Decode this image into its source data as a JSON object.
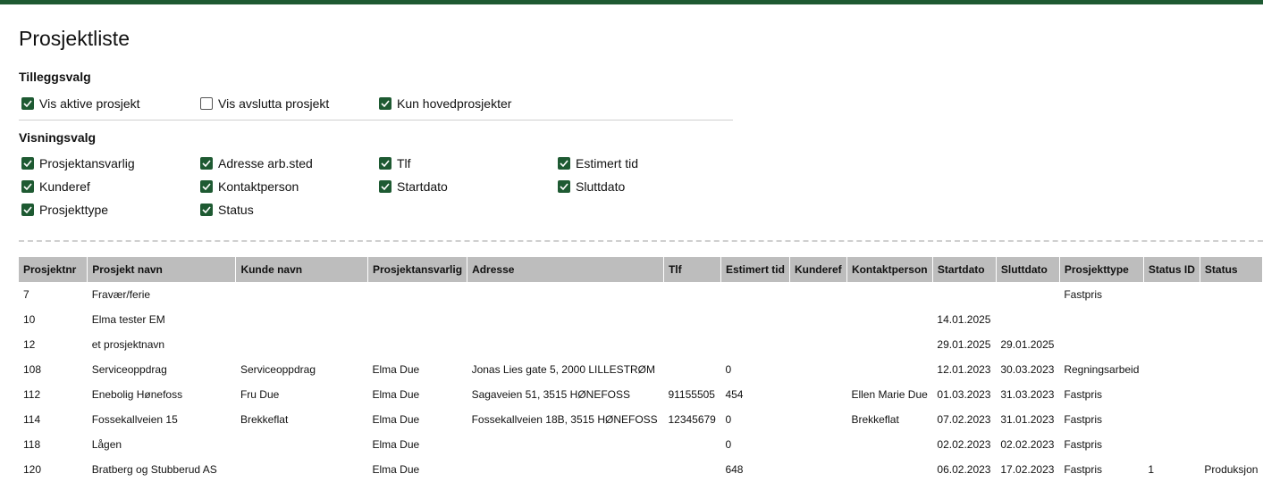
{
  "page": {
    "title": "Prosjektliste",
    "accent": "#1e5a32"
  },
  "tillegg": {
    "title": "Tilleggsvalg",
    "options": [
      {
        "label": "Vis aktive prosjekt",
        "checked": true
      },
      {
        "label": "Vis avslutta prosjekt",
        "checked": false
      },
      {
        "label": "Kun hovedprosjekter",
        "checked": true
      }
    ]
  },
  "visning": {
    "title": "Visningsvalg",
    "options": [
      {
        "label": "Prosjektansvarlig",
        "checked": true
      },
      {
        "label": "Adresse arb.sted",
        "checked": true
      },
      {
        "label": "Tlf",
        "checked": true
      },
      {
        "label": "Estimert tid",
        "checked": true
      },
      {
        "label": "Kunderef",
        "checked": true
      },
      {
        "label": "Kontaktperson",
        "checked": true
      },
      {
        "label": "Startdato",
        "checked": true
      },
      {
        "label": "Sluttdato",
        "checked": true
      },
      {
        "label": "Prosjekttype",
        "checked": true
      },
      {
        "label": "Status",
        "checked": true
      }
    ]
  },
  "table": {
    "columns": [
      "Prosjektnr",
      "Prosjekt navn",
      "Kunde navn",
      "Prosjektansvarlig",
      "Adresse",
      "Tlf",
      "Estimert tid",
      "Kunderef",
      "Kontaktperson",
      "Startdato",
      "Sluttdato",
      "Prosjekttype",
      "Status ID",
      "Status"
    ],
    "rows": [
      [
        "7",
        "Fravær/ferie",
        "",
        "",
        "",
        "",
        "",
        "",
        "",
        "",
        "",
        "Fastpris",
        "",
        ""
      ],
      [
        "10",
        "Elma tester EM",
        "",
        "",
        "",
        "",
        "",
        "",
        "",
        "14.01.2025",
        "",
        "",
        "",
        ""
      ],
      [
        "12",
        "et prosjektnavn",
        "",
        "",
        "",
        "",
        "",
        "",
        "",
        "29.01.2025",
        "29.01.2025",
        "",
        "",
        ""
      ],
      [
        "108",
        "Serviceoppdrag",
        "Serviceoppdrag",
        "Elma Due",
        "Jonas Lies gate 5, 2000 LILLESTRØM",
        "",
        "0",
        "",
        "",
        "12.01.2023",
        "30.03.2023",
        "Regningsarbeid",
        "",
        ""
      ],
      [
        "112",
        "Enebolig Hønefoss",
        "Fru Due",
        "Elma Due",
        "Sagaveien 51, 3515 HØNEFOSS",
        "91155505",
        "454",
        "",
        "Ellen Marie Due",
        "01.03.2023",
        "31.03.2023",
        "Fastpris",
        "",
        ""
      ],
      [
        "114",
        "Fossekallveien 15",
        "Brekkeflat",
        "Elma Due",
        "Fossekallveien 18B, 3515 HØNEFOSS",
        "12345679",
        "0",
        "",
        "Brekkeflat",
        "07.02.2023",
        "31.01.2023",
        "Fastpris",
        "",
        ""
      ],
      [
        "118",
        "Lågen",
        "",
        "Elma Due",
        "",
        "",
        "0",
        "",
        "",
        "02.02.2023",
        "02.02.2023",
        "Fastpris",
        "",
        ""
      ],
      [
        "120",
        "Bratberg og Stubberud AS",
        "",
        "Elma Due",
        "",
        "",
        "648",
        "",
        "",
        "06.02.2023",
        "17.02.2023",
        "Fastpris",
        "1",
        "Produksjon"
      ]
    ]
  }
}
